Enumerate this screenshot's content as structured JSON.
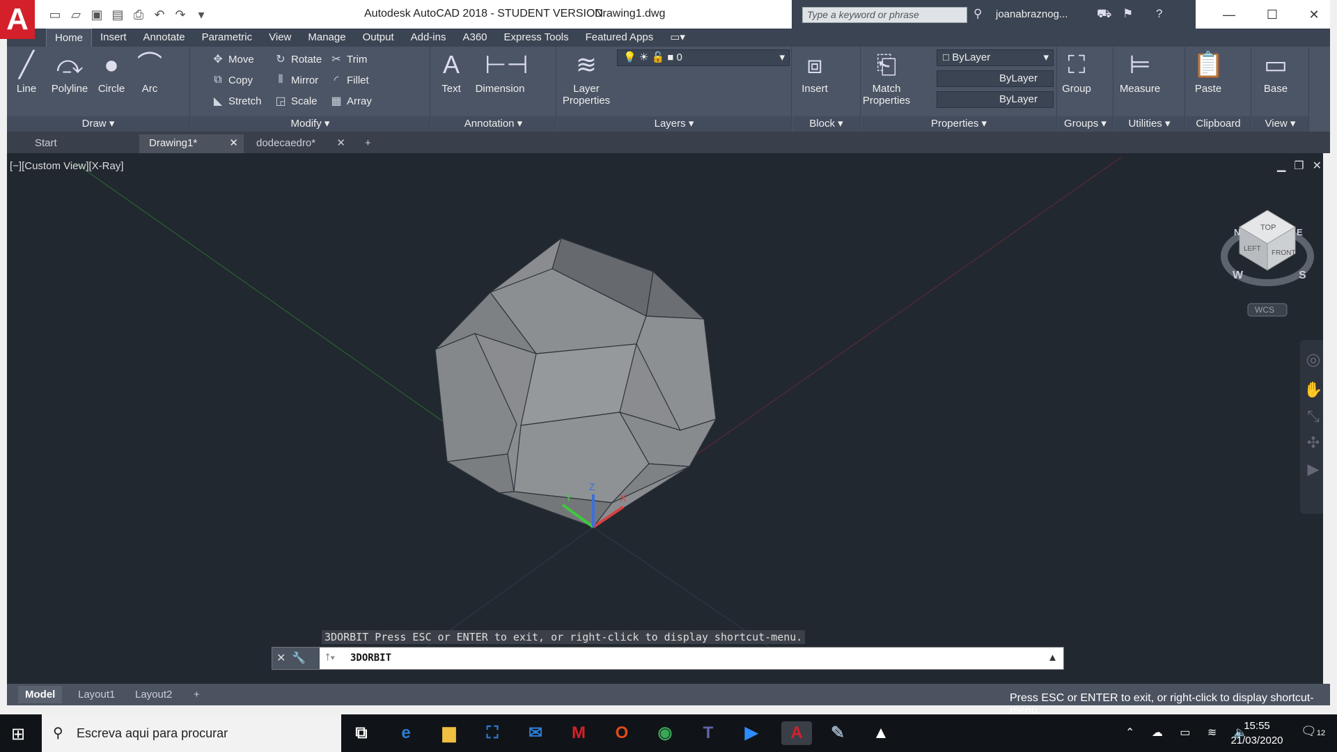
{
  "titlebar": {
    "logo": "A",
    "title": "Autodesk AutoCAD 2018 - STUDENT VERSION",
    "file": "Drawing1.dwg",
    "search_placeholder": "Type a keyword or phrase",
    "user": "joanabraznog..."
  },
  "tabs": [
    "Home",
    "Insert",
    "Annotate",
    "Parametric",
    "View",
    "Manage",
    "Output",
    "Add-ins",
    "A360",
    "Express Tools",
    "Featured Apps"
  ],
  "draw": {
    "line": "Line",
    "polyline": "Polyline",
    "circle": "Circle",
    "arc": "Arc",
    "title": "Draw"
  },
  "modify": {
    "move": "Move",
    "rotate": "Rotate",
    "trim": "Trim",
    "copy": "Copy",
    "mirror": "Mirror",
    "fillet": "Fillet",
    "stretch": "Stretch",
    "scale": "Scale",
    "array": "Array",
    "title": "Modify"
  },
  "annotation": {
    "text": "Text",
    "dimension": "Dimension",
    "title": "Annotation"
  },
  "layers": {
    "layer_properties": "Layer Properties",
    "current_layer": "0",
    "title": "Layers"
  },
  "block": {
    "insert": "Insert",
    "title": "Block"
  },
  "properties": {
    "match": "Match Properties",
    "color": "ByLayer",
    "linetype": "ByLayer",
    "lineweight": "ByLayer",
    "title": "Properties"
  },
  "groups": {
    "group": "Group",
    "title": "Groups"
  },
  "utilities": {
    "measure": "Measure",
    "title": "Utilities"
  },
  "clipboard": {
    "paste": "Paste",
    "title": "Clipboard"
  },
  "view": {
    "base": "Base",
    "title": "View"
  },
  "doc_tabs": [
    "Start",
    "Drawing1*",
    "dodecaedro*"
  ],
  "viewport": {
    "label": "[−][Custom View][X-Ray]",
    "wcs": "WCS",
    "cube_top": "TOP",
    "cube_left": "LEFT",
    "cube_front": "FRONT",
    "compass_w": "W",
    "compass_s": "S",
    "compass_n": "N",
    "compass_e": "E",
    "axis_x": "X",
    "axis_y": "Y",
    "axis_z": "Z"
  },
  "command": {
    "hint": "3DORBIT Press ESC or ENTER to exit, or right-click to display shortcut-menu.",
    "input": "3DORBIT"
  },
  "layout_tabs": [
    "Model",
    "Layout1",
    "Layout2"
  ],
  "status": {
    "message": "Press ESC or ENTER to exit, or right-click to display shortcut-menu."
  },
  "taskbar": {
    "search": "Escreva aqui para procurar",
    "time": "15:55",
    "date": "21/03/2020",
    "notif": "12"
  }
}
